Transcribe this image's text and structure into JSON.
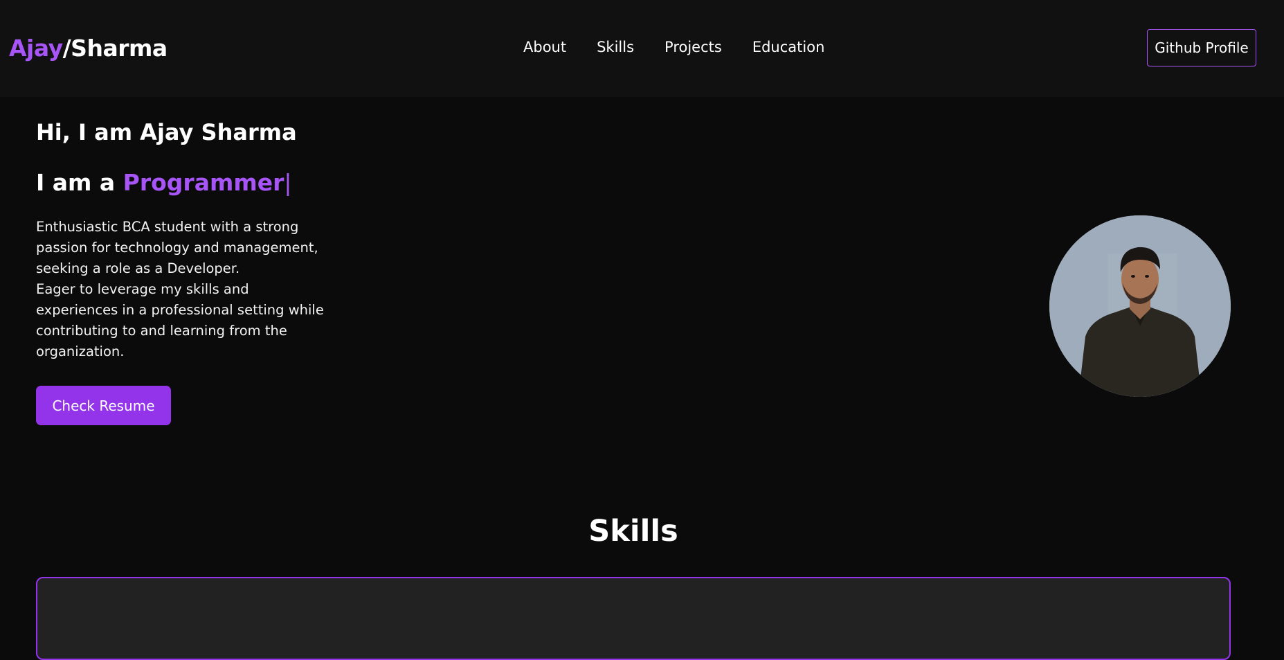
{
  "header": {
    "logo_first": "Ajay",
    "logo_rest": "/Sharma",
    "nav": [
      "About",
      "Skills",
      "Projects",
      "Education"
    ],
    "github_label": "Github Profile"
  },
  "hero": {
    "greeting": "Hi, I am Ajay Sharma",
    "role_prefix": "I am a ",
    "role_word": "Programmer",
    "cursor": "|",
    "description_1": "Enthusiastic BCA student with a strong passion for technology and management, seeking a role as a Developer.",
    "description_2": "Eager to leverage my skills and experiences in a professional setting while contributing to and learning from the organization.",
    "resume_label": "Check Resume"
  },
  "skills": {
    "title": "Skills"
  },
  "colors": {
    "accent": "#a855f7",
    "button": "#9333ea",
    "background": "#0b0b0c",
    "navbar": "#111112",
    "panel": "#222222"
  }
}
